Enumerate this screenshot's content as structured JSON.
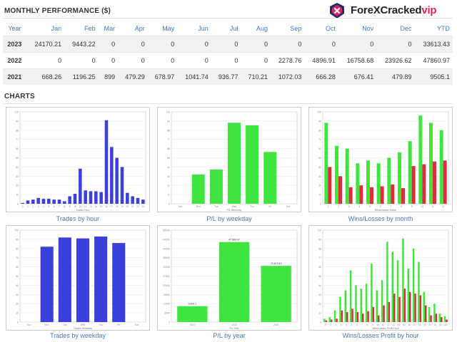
{
  "logo": {
    "name": "ForeXCracked",
    "suffix": "vip"
  },
  "monthly": {
    "title": "MONTHLY PERFORMANCE ($)",
    "headers": [
      "Year",
      "Jan",
      "Feb",
      "Mar",
      "Apr",
      "May",
      "Jun",
      "Jul",
      "Aug",
      "Sep",
      "Oct",
      "Nov",
      "Dec",
      "YTD"
    ],
    "rows": [
      [
        "2023",
        "24170.21",
        "9443.22",
        "0",
        "0",
        "0",
        "0",
        "0",
        "0",
        "0",
        "0",
        "0",
        "0",
        "33613.43"
      ],
      [
        "2022",
        "0",
        "0",
        "0",
        "0",
        "0",
        "0",
        "0",
        "0",
        "2278.76",
        "4896.91",
        "16758.68",
        "23926.62",
        "47860.97"
      ],
      [
        "2021",
        "668.26",
        "1196.25",
        "899",
        "479.29",
        "678.97",
        "1041.74",
        "936.77",
        "710.21",
        "1072.03",
        "666.28",
        "676.41",
        "479.89",
        "9505.1"
      ]
    ]
  },
  "charts_section": {
    "title": "CHARTS"
  },
  "colors": {
    "blue": "#3b3fdc",
    "green": "#3fe43f",
    "red": "#dc2d3c",
    "caption": "#4a76a8"
  },
  "chart_data": [
    {
      "type": "bar",
      "title": "Trades by hour",
      "xlabel": "Trades Hour",
      "categories": [
        "0",
        "1",
        "2",
        "3",
        "4",
        "5",
        "6",
        "7",
        "8",
        "9",
        "10",
        "11",
        "12",
        "13",
        "14",
        "15",
        "16",
        "17",
        "18",
        "19",
        "20",
        "21",
        "22",
        "23"
      ],
      "values": [
        1,
        4,
        5,
        7,
        6,
        6,
        5,
        5,
        3,
        9,
        12,
        42,
        16,
        15,
        15,
        14,
        100,
        68,
        55,
        44,
        13,
        9,
        7,
        5
      ],
      "ylim": [
        0,
        110
      ]
    },
    {
      "type": "bar",
      "title": "P/L by weekday",
      "xlabel": "P/L Weekday",
      "categories": [
        "Sun",
        "Mon",
        "Tue",
        "Wed",
        "Thu",
        "Fri",
        "Sat"
      ],
      "values": [
        0,
        35,
        41,
        97,
        94,
        62,
        0
      ],
      "ylim": [
        0,
        110
      ]
    },
    {
      "type": "bar",
      "title": "Wins/Losses by month",
      "xlabel": "Wins/Losses Month",
      "categories": [
        "1",
        "2",
        "3",
        "4",
        "5",
        "6",
        "7",
        "8",
        "9",
        "10",
        "11",
        "12"
      ],
      "series": [
        {
          "values": [
            88,
            63,
            60,
            44,
            47,
            44,
            50,
            56,
            68,
            96,
            88,
            80
          ]
        },
        {
          "values": [
            40,
            30,
            18,
            20,
            18,
            19,
            21,
            17,
            41,
            43,
            46,
            47
          ]
        }
      ],
      "ylim": [
        0,
        100
      ]
    },
    {
      "type": "bar",
      "title": "Trades by weekday",
      "xlabel": "Trades Weekday",
      "categories": [
        "Sun",
        "Mon",
        "Tue",
        "Wed",
        "Thu",
        "Fri",
        "Sat"
      ],
      "values": [
        0,
        82,
        92,
        91,
        93,
        86,
        0
      ],
      "ylim": [
        0,
        100
      ]
    },
    {
      "type": "bar",
      "title": "P/L by year",
      "xlabel": "P/L Year",
      "categories": [
        "2021",
        "2022",
        "2023"
      ],
      "values": [
        9505.1,
        47860.97,
        33613.43
      ],
      "value_labels": [
        "9,505.1",
        "47,860.97",
        "33,613.43"
      ],
      "ylim": [
        0,
        55000
      ]
    },
    {
      "type": "bar",
      "title": "Wins/Losses Profit by hour",
      "xlabel": "Wins/Losses Profit Hour",
      "categories": [
        "0",
        "1",
        "2",
        "3",
        "4",
        "5",
        "6",
        "7",
        "8",
        "9",
        "10",
        "11",
        "12",
        "13",
        "14",
        "15",
        "16",
        "17",
        "18",
        "19",
        "20",
        "21",
        "22",
        "23"
      ],
      "series": [
        {
          "values": [
            4,
            6,
            14,
            30,
            38,
            62,
            44,
            40,
            46,
            70,
            38,
            50,
            96,
            84,
            74,
            100,
            64,
            88,
            72,
            36,
            18,
            22,
            10,
            7
          ]
        },
        {
          "values": [
            2,
            3,
            4,
            14,
            12,
            16,
            12,
            10,
            13,
            18,
            8,
            20,
            24,
            34,
            30,
            40,
            36,
            34,
            32,
            20,
            8,
            10,
            6,
            3
          ]
        }
      ],
      "ylim": [
        0,
        110
      ]
    }
  ]
}
